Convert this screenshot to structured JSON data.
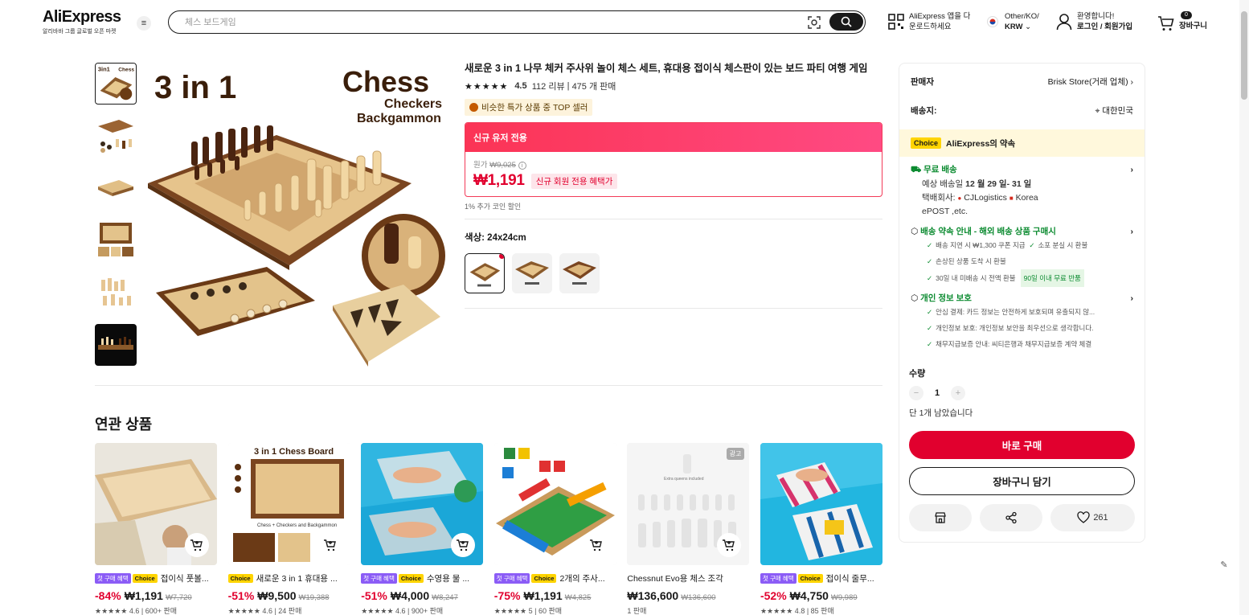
{
  "header": {
    "logo": "AliExpress",
    "logo_sub": "알리바바 그룹 글로벌 오픈 마켓",
    "search_placeholder": "체스 보드게임",
    "app_line1": "AliExpress 앱을 다",
    "app_line2": "운로드하세요",
    "region_line1": "Other/KO/",
    "region_line2": "KRW",
    "account_line1": "환영합니다!",
    "account_line2": "로그인 / 회원가입",
    "cart_count": "0",
    "cart_label": "장바구니"
  },
  "product": {
    "title": "새로운 3 in 1 나무 체커 주사위 놀이 체스 세트, 휴대용 접이식 체스판이 있는 보드 파티 여행 게임",
    "rating": "4.5",
    "reviews": "112 리뷰",
    "sold": "475 개 판매",
    "top_seller": "비슷한 특가 상품 중 TOP 셀러",
    "promo_header": "신규 유저 전용",
    "orig_label": "원가",
    "orig_price": "₩9,025",
    "price": "₩1,191",
    "price_badge": "신규 회원 전용 혜택가",
    "coin_note": "1% 추가 코인 할인",
    "color_label": "색상: 24x24cm",
    "main_image": {
      "title_big": "3 in 1",
      "title_chess": "Chess",
      "title_checkers": "Checkers",
      "title_backgammon": "Backgammon"
    }
  },
  "related": {
    "title": "연관 상품",
    "items": [
      {
        "first": "첫 구매 혜택",
        "choice": "Choice",
        "name": "접이식 풋볼...",
        "disc": "-84%",
        "price": "₩1,191",
        "was": "₩7,720",
        "meta": "★★★★★ 4.6 | 600+ 판매"
      },
      {
        "first": "",
        "choice": "Choice",
        "name": "새로운 3 in 1 휴대용 ...",
        "disc": "-51%",
        "price": "₩9,500",
        "was": "₩19,388",
        "meta": "★★★★★ 4.6 | 24 판매",
        "img_label": "3 in 1 Chess Board",
        "img_sub": "Chess + Checkers and Backgammon"
      },
      {
        "first": "첫 구매 혜택",
        "choice": "Choice",
        "name": "수영용 물 ...",
        "disc": "-51%",
        "price": "₩4,000",
        "was": "₩8,247",
        "meta": "★★★★★ 4.6 | 900+ 판매"
      },
      {
        "first": "첫 구매 혜택",
        "choice": "Choice",
        "name": "2개의 주사...",
        "disc": "-75%",
        "price": "₩1,191",
        "was": "₩4,825",
        "meta": "★★★★★ 5 | 60 판매"
      },
      {
        "first": "",
        "choice": "",
        "name": "Chessnut Evo용 체스 조각",
        "disc": "",
        "price": "₩136,600",
        "was": "₩136,600",
        "meta": "1 판매",
        "ad": "광고",
        "img_label": "Extra queens included"
      },
      {
        "first": "첫 구매 혜택",
        "choice": "Choice",
        "name": "접이식 줄무...",
        "disc": "-52%",
        "price": "₩4,750",
        "was": "₩9,989",
        "meta": "★★★★★ 4.8 | 85 판매"
      }
    ]
  },
  "panel": {
    "seller_label": "판매자",
    "seller_value": "Brisk Store(거래 업체)",
    "ship_label": "배송지:",
    "ship_value": "대한민국",
    "choice_pill": "Choice",
    "choice_text": "AliExpress의 약속",
    "free_ship": "무료 배송",
    "eta_prefix": "예상 배송일",
    "eta_value": "12 월 29 일- 31 일",
    "courier_prefix": "택배회사:",
    "courier_1": "CJLogistics",
    "courier_2": "Korea",
    "courier_3": "ePOST ,etc.",
    "promise_title": "배송 약속 안내 - 해외 배송 상품 구매시",
    "promise_a": "배송 지연 시 ₩1,300 쿠폰 지급",
    "promise_b": "소포 분실 시 환불",
    "promise_c": "손상된 상품 도착 시 환불",
    "promise_d": "30일 내 미배송 시 전액 환불",
    "promise_badge": "90일 이내 무료 반품",
    "privacy_title": "개인 정보 보호",
    "privacy_a": "안심 결제: 카드 정보는 안전하게 보호되며 유출되지 않...",
    "privacy_b": "개인정보 보호: 개인정보 보안을 최우선으로 생각합니다.",
    "privacy_c": "채무지급보증 안내: 씨티은행과 채무지급보증 계약 체결",
    "qty_label": "수량",
    "qty_minus": "−",
    "qty_value": "1",
    "qty_plus": "+",
    "stock": "단 1개 남았습니다",
    "buy_now": "바로 구매",
    "add_cart": "장바구니 담기",
    "wishlist_count": "261"
  },
  "colors": {
    "accent": "#e1002e",
    "choice": "#ffd400",
    "green": "#0a8a2f",
    "promo_start": "#fb3455",
    "promo_end": "#ff4a83"
  }
}
